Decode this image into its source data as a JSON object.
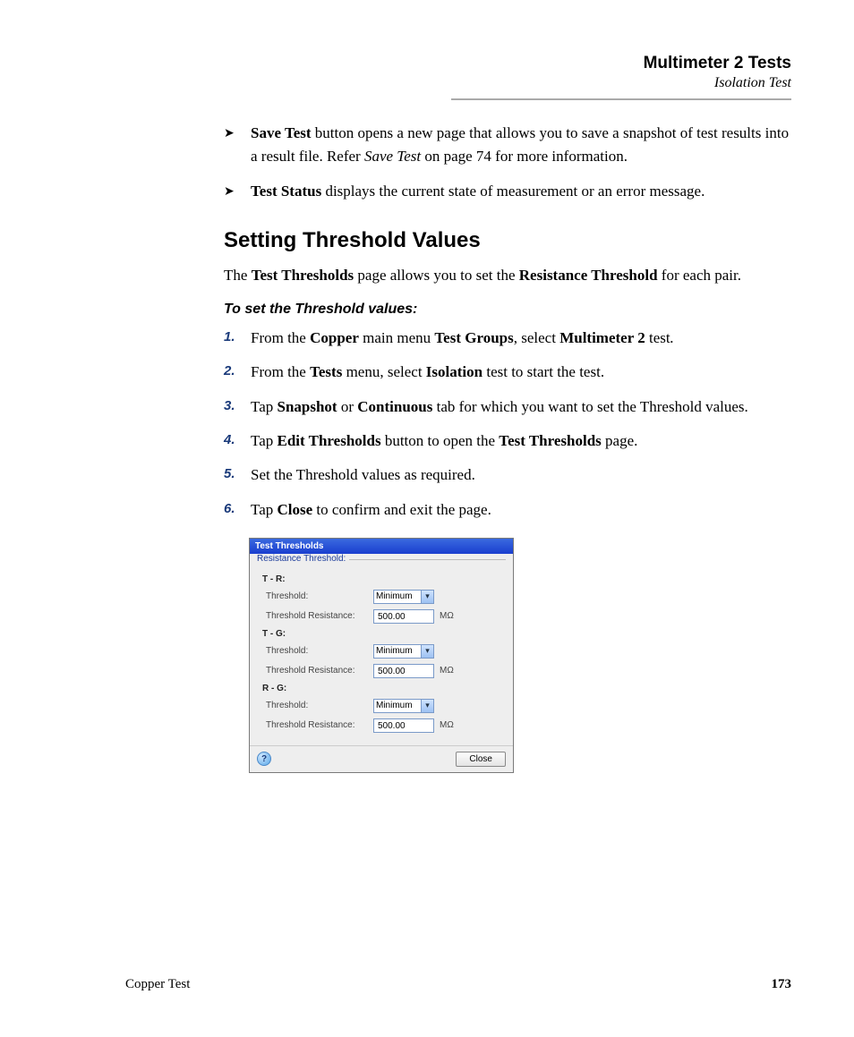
{
  "header": {
    "title": "Multimeter 2 Tests",
    "subtitle": "Isolation Test"
  },
  "bullets": [
    {
      "lead": "Save Test",
      "rest_a": " button opens a new page that allows you to save a snapshot of test results into a result file. Refer ",
      "ital": "Save Test",
      "rest_b": " on page 74 for more information."
    },
    {
      "lead": "Test Status",
      "rest_a": " displays the current state of measurement or an error message.",
      "ital": "",
      "rest_b": ""
    }
  ],
  "section_heading": "Setting Threshold Values",
  "intro": {
    "a": "The ",
    "b1": "Test Thresholds",
    "c": " page allows you to set the ",
    "b2": "Resistance Threshold",
    "d": " for each pair."
  },
  "proc_title": "To set the Threshold values:",
  "steps": [
    {
      "t1": "From the ",
      "b1": "Copper",
      "t2": " main menu ",
      "b2": "Test Groups",
      "t3": ", select ",
      "b3": "Multimeter 2",
      "t4": " test",
      "trailing_ital": "."
    },
    {
      "t1": "From the ",
      "b1": "Tests",
      "t2": " menu, select ",
      "b2": "Isolation",
      "t3": " test to start the test.",
      "b3": "",
      "t4": "",
      "trailing_ital": ""
    },
    {
      "t1": "Tap ",
      "b1": "Snapshot",
      "t2": " or ",
      "b2": "Continuous",
      "t3": " tab for which you want to set the Threshold values.",
      "b3": "",
      "t4": "",
      "trailing_ital": ""
    },
    {
      "t1": "Tap ",
      "b1": "Edit Thresholds",
      "t2": " button to open the ",
      "b2": "Test Thresholds",
      "t3": " page.",
      "b3": "",
      "t4": "",
      "trailing_ital": ""
    },
    {
      "t1": "Set the Threshold values as required.",
      "b1": "",
      "t2": "",
      "b2": "",
      "t3": "",
      "b3": "",
      "t4": "",
      "trailing_ital": ""
    },
    {
      "t1": "Tap ",
      "b1": "Close",
      "t2": " to confirm and exit the page.",
      "b2": "",
      "t3": "",
      "b3": "",
      "t4": "",
      "trailing_ital": ""
    }
  ],
  "dialog": {
    "title": "Test Thresholds",
    "legend": "Resistance Threshold:",
    "groups": [
      {
        "name": "T - R:",
        "threshold_label": "Threshold:",
        "threshold_value": "Minimum",
        "resist_label": "Threshold Resistance:",
        "resist_value": "500.00",
        "unit": "MΩ"
      },
      {
        "name": "T - G:",
        "threshold_label": "Threshold:",
        "threshold_value": "Minimum",
        "resist_label": "Threshold Resistance:",
        "resist_value": "500.00",
        "unit": "MΩ"
      },
      {
        "name": "R - G:",
        "threshold_label": "Threshold:",
        "threshold_value": "Minimum",
        "resist_label": "Threshold Resistance:",
        "resist_value": "500.00",
        "unit": "MΩ"
      }
    ],
    "help": "?",
    "close": "Close"
  },
  "footer": {
    "left": "Copper Test",
    "page": "173"
  }
}
